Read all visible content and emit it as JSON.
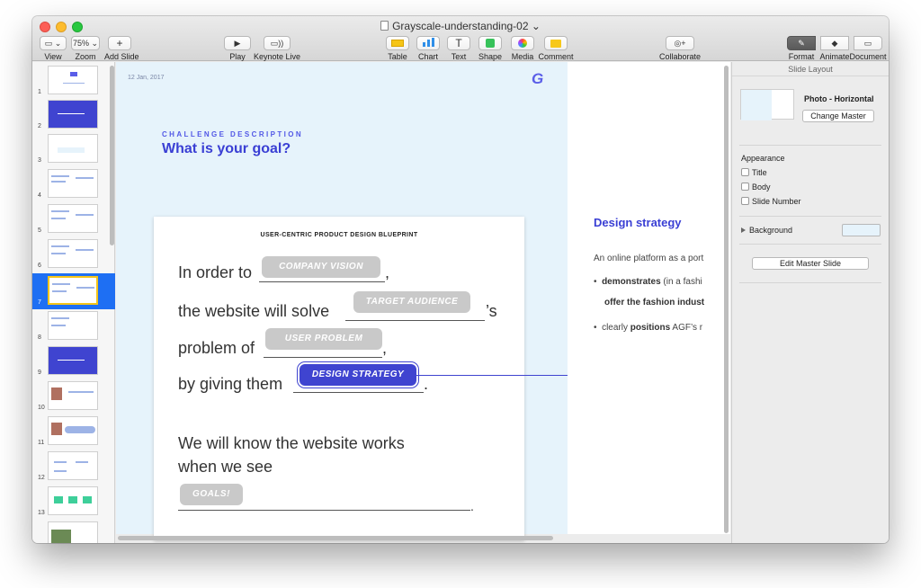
{
  "window": {
    "title": "Grayscale-understanding-02"
  },
  "toolbar": {
    "view": {
      "btn": "▭ ⌄",
      "label": "View"
    },
    "zoom": {
      "btn": "75% ⌄",
      "label": "Zoom"
    },
    "add_slide": {
      "btn": "+",
      "label": "Add Slide"
    },
    "play": {
      "btn": "▶",
      "label": "Play"
    },
    "keynote_live": {
      "btn": "▭))",
      "label": "Keynote Live"
    },
    "table": {
      "label": "Table"
    },
    "chart": {
      "label": "Chart"
    },
    "text": {
      "btn": "T",
      "label": "Text"
    },
    "shape": {
      "label": "Shape"
    },
    "media": {
      "label": "Media"
    },
    "comment": {
      "label": "Comment"
    },
    "collaborate": {
      "label": "Collaborate"
    },
    "format": {
      "label": "Format"
    },
    "animate": {
      "label": "Animate"
    },
    "document": {
      "label": "Document"
    }
  },
  "navigator": {
    "slides": [
      "1",
      "2",
      "3",
      "4",
      "5",
      "6",
      "7",
      "8",
      "9",
      "10",
      "11",
      "12",
      "13"
    ],
    "selected": "7"
  },
  "slide": {
    "date": "12 Jan, 2017",
    "logo": "G",
    "eyebrow": "CHALLENGE DESCRIPTION",
    "heading": "What is your goal?",
    "card_title": "USER-CENTRIC PRODUCT DESIGN BLUEPRINT",
    "line1_prefix": "In order to",
    "line1_suffix": ",",
    "line2_prefix": "the website will solve",
    "line2_suffix": "’s",
    "line3_prefix": "problem of",
    "line3_suffix": ",",
    "line4_prefix": "by giving them",
    "line4_suffix": ".",
    "closing_1": "We will know the website works",
    "closing_2": "when we see",
    "closing_suffix": ".",
    "chips": {
      "company_vision": "COMPANY VISION",
      "target_audience": "TARGET AUDIENCE",
      "user_problem": "USER PROBLEM",
      "design_strategy": "DESIGN STRATEGY",
      "goals": "GOALS!"
    },
    "design_strategy": {
      "title": "Design strategy",
      "text1": "An online platform as a port",
      "bullet1_bold": "demonstrates",
      "bullet1_rest": " (in a fashi",
      "bullet1_line2": "offer the fashion indust",
      "bullet2_pre": "clearly ",
      "bullet2_bold": "positions",
      "bullet2_rest": " AGF’s r"
    }
  },
  "inspector": {
    "header": "Slide Layout",
    "master_name": "Photo - Horizontal",
    "change_master": "Change Master",
    "appearance": "Appearance",
    "options": [
      "Title",
      "Body",
      "Slide Number"
    ],
    "background": "Background",
    "background_color": "#e6f3fb",
    "edit_master": "Edit Master Slide"
  },
  "colors": {
    "accent": "#3f44d0",
    "selection": "#1e6ff3"
  }
}
